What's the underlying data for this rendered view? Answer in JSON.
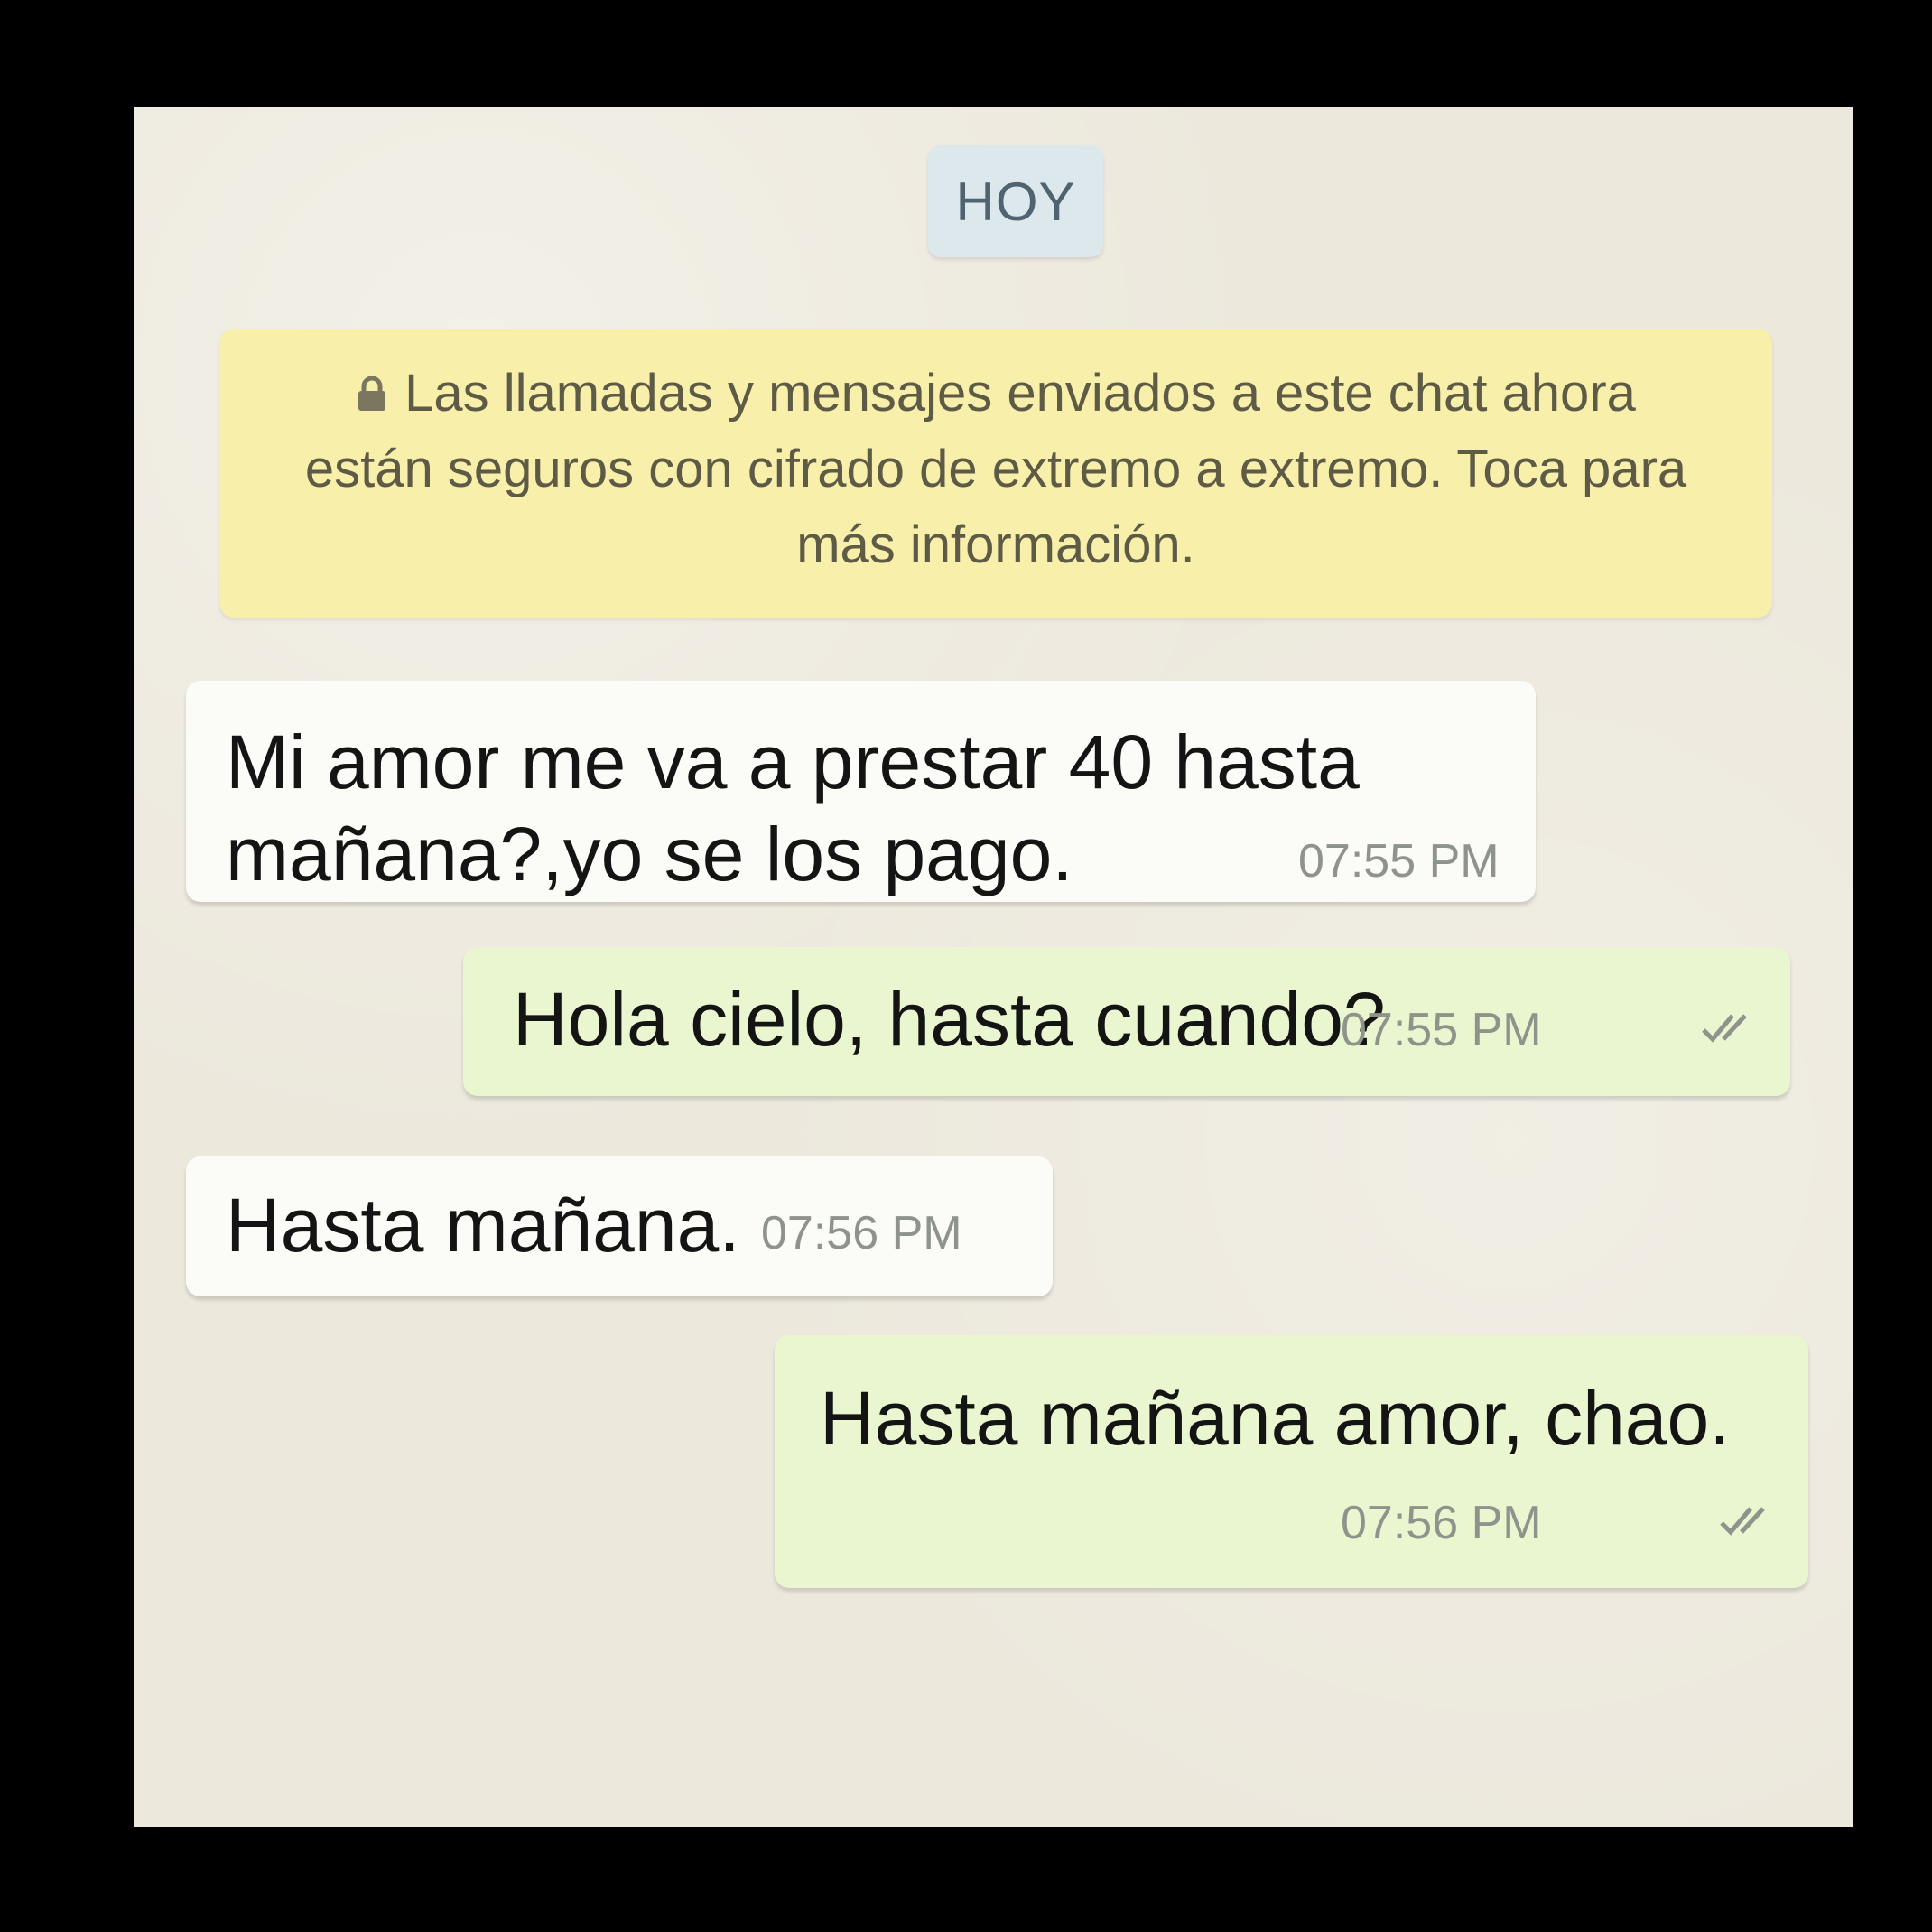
{
  "chat": {
    "date_label": "HOY",
    "encryption_notice": "Las llamadas y mensajes enviados a este chat ahora están seguros con cifrado de extremo a extremo. Toca para más información.",
    "messages": [
      {
        "direction": "incoming",
        "line1": "Mi amor me va a prestar 40 hasta",
        "line2": "mañana?,yo se los pago.",
        "time": "07:55 PM"
      },
      {
        "direction": "outgoing",
        "text": "Hola cielo, hasta cuando?",
        "time": "07:55 PM",
        "status_icon": "double-check-icon"
      },
      {
        "direction": "incoming",
        "text": "Hasta mañana.",
        "time": "07:56 PM"
      },
      {
        "direction": "outgoing",
        "text": "Hasta mañana amor, chao.",
        "time": "07:56 PM",
        "status_icon": "double-check-icon"
      }
    ]
  },
  "colors": {
    "background": "#ece8dc",
    "incoming_bubble": "#fbfbf8",
    "outgoing_bubble": "#e9f6cf",
    "notice_bubble": "#f8efaa",
    "date_chip": "#dde8ec",
    "timestamp": "#8e938c"
  }
}
